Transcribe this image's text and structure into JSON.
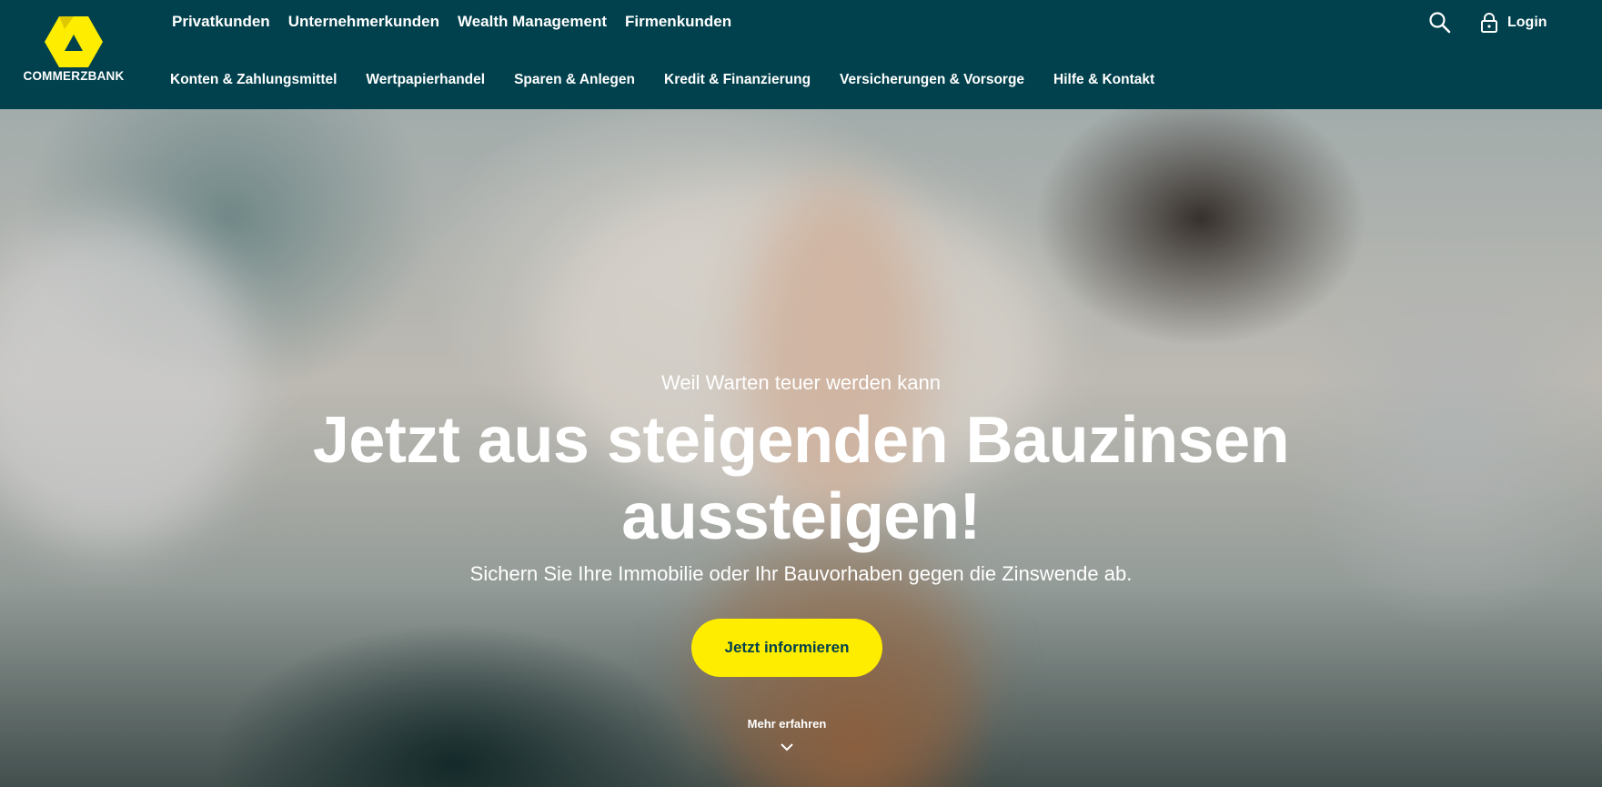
{
  "brand": {
    "name": "COMMERZBANK",
    "accent": "#ffed00",
    "header_bg": "#00414d"
  },
  "topnav": [
    {
      "label": "Privatkunden"
    },
    {
      "label": "Unternehmerkunden"
    },
    {
      "label": "Wealth Management"
    },
    {
      "label": "Firmenkunden"
    }
  ],
  "subnav": [
    {
      "label": "Konten & Zahlungsmittel"
    },
    {
      "label": "Wertpapierhandel"
    },
    {
      "label": "Sparen & Anlegen"
    },
    {
      "label": "Kredit & Finanzierung"
    },
    {
      "label": "Versicherungen & Vorsorge"
    },
    {
      "label": "Hilfe & Kontakt"
    }
  ],
  "header_actions": {
    "search_icon": "search-icon",
    "login_label": "Login",
    "login_icon": "lock-icon"
  },
  "hero": {
    "eyebrow": "Weil Warten teuer werden kann",
    "headline_line1": "Jetzt aus steigenden Bauzinsen",
    "headline_line2": "aussteigen!",
    "subline": "Sichern Sie Ihre Immobilie oder Ihr Bauvorhaben gegen die Zinswende ab.",
    "cta_label": "Jetzt informieren",
    "more_label": "Mehr erfahren"
  }
}
